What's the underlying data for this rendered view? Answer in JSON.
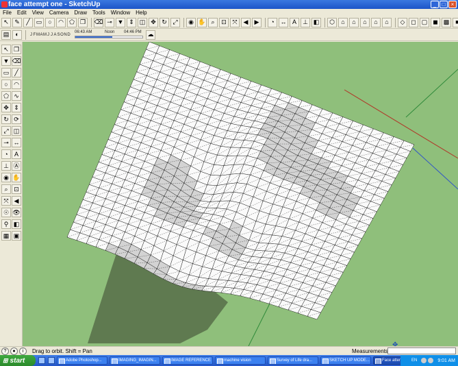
{
  "window": {
    "title": "face attempt one - SketchUp"
  },
  "menu": [
    "File",
    "Edit",
    "View",
    "Camera",
    "Draw",
    "Tools",
    "Window",
    "Help"
  ],
  "toolbar1_icons": [
    "select-icon",
    "pencil-icon",
    "line-icon",
    "rectangle-icon",
    "circle-icon",
    "arc-icon",
    "polygon-icon",
    "make-component-icon",
    "eraser-icon",
    "tape-measure-icon",
    "paint-bucket-icon",
    "push-pull-icon",
    "offset-icon",
    "move-icon",
    "rotate-icon",
    "scale-icon",
    "orbit-icon",
    "pan-icon",
    "zoom-icon",
    "zoom-window-icon",
    "zoom-extents-icon",
    "previous-view-icon",
    "next-view-icon",
    "protractor-icon",
    "dimension-icon",
    "text-icon",
    "axes-icon",
    "section-plane-icon",
    "iso-view-icon",
    "top-view-icon",
    "front-view-icon",
    "right-view-icon",
    "back-view-icon",
    "left-view-icon",
    "xray-icon",
    "wireframe-icon",
    "hidden-line-icon",
    "shaded-icon",
    "shaded-texture-icon",
    "monochrome-icon"
  ],
  "shadow_settings": {
    "months": [
      "J",
      "F",
      "M",
      "A",
      "M",
      "J",
      "J",
      "A",
      "S",
      "O",
      "N",
      "D"
    ],
    "time_start": "06:43 AM",
    "time_noon": "Noon",
    "time_end": "04:46 PM",
    "time_position": 0.55
  },
  "left_tools": [
    "select-icon",
    "make-component-icon",
    "paint-bucket-icon",
    "eraser-icon",
    "rectangle-icon",
    "line-icon",
    "circle-icon",
    "arc-icon",
    "polygon-icon",
    "freehand-icon",
    "move-icon",
    "push-pull-icon",
    "rotate-icon",
    "follow-me-icon",
    "scale-icon",
    "offset-icon",
    "tape-measure-icon",
    "dimension-icon",
    "protractor-icon",
    "text-icon",
    "axes-icon",
    "3d-text-icon",
    "orbit-icon",
    "pan-icon",
    "zoom-icon",
    "zoom-window-icon",
    "zoom-extents-icon",
    "previous-icon",
    "position-camera-icon",
    "look-around-icon",
    "walk-icon",
    "section-plane-icon",
    "sandbox-icon",
    "component-icon"
  ],
  "status": {
    "hint": "Drag to orbit.  Shift = Pan",
    "measurements_label": "Measurements",
    "measurements_value": ""
  },
  "taskbar": {
    "start": "start",
    "tasks": [
      "Adobe Photoshop...",
      "IMAGING_IMAGIN...",
      "IMAGE REFERENCE",
      "machine vision",
      "Survey of Life dra...",
      "SKETCH UP MODE...",
      "Face attempt one ..."
    ],
    "active_task_index": 6,
    "lang": "EN",
    "clock": "9:01 AM"
  },
  "colors": {
    "ground": "#8fbf7b",
    "shadow": "#5f7a50",
    "mesh_face": "#fafafa",
    "mesh_edge": "#222222",
    "mesh_shade": "#d3d3d3"
  }
}
